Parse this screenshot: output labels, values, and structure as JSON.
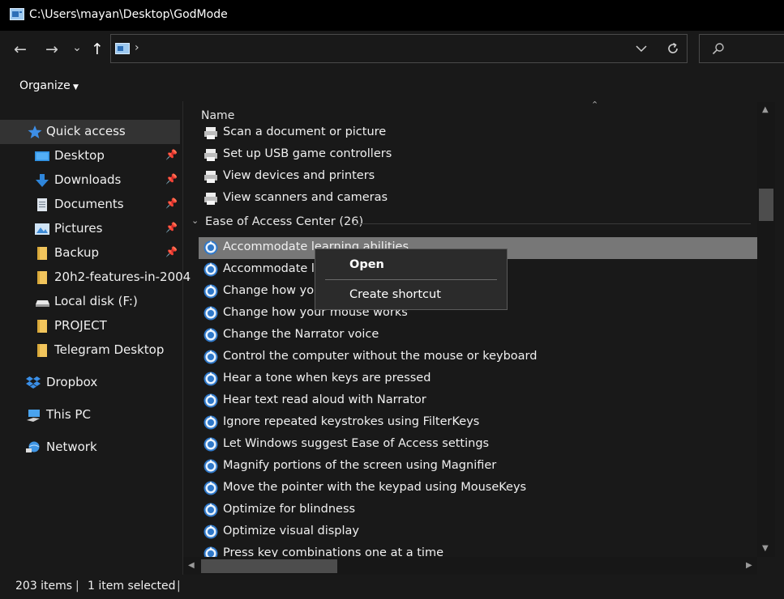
{
  "window": {
    "title": "C:\\Users\\mayan\\Desktop\\GodMode"
  },
  "address": {
    "chevron": "›",
    "dropdown_icon": "chevron-down-icon",
    "refresh_icon": "refresh-icon"
  },
  "nav": {
    "back": "←",
    "forward": "→",
    "recent": "⌄",
    "up": "↑"
  },
  "toolbar": {
    "organize": "Organize"
  },
  "sidebar": {
    "items": [
      {
        "label": "Quick access",
        "icon": "star-icon",
        "pinned": false
      },
      {
        "label": "Desktop",
        "icon": "desktop-icon",
        "pinned": true
      },
      {
        "label": "Downloads",
        "icon": "download-icon",
        "pinned": true
      },
      {
        "label": "Documents",
        "icon": "document-icon",
        "pinned": true
      },
      {
        "label": "Pictures",
        "icon": "pictures-icon",
        "pinned": true
      },
      {
        "label": "Backup",
        "icon": "folder-icon",
        "pinned": true
      },
      {
        "label": "20h2-features-in-2004",
        "icon": "folder-icon",
        "pinned": false
      },
      {
        "label": "Local disk (F:)",
        "icon": "drive-icon",
        "pinned": false
      },
      {
        "label": "PROJECT",
        "icon": "folder-icon",
        "pinned": false
      },
      {
        "label": "Telegram Desktop",
        "icon": "folder-icon",
        "pinned": false
      },
      {
        "label": "Dropbox",
        "icon": "dropbox-icon",
        "pinned": false
      },
      {
        "label": "This PC",
        "icon": "pc-icon",
        "pinned": false
      },
      {
        "label": "Network",
        "icon": "network-icon",
        "pinned": false
      }
    ]
  },
  "list": {
    "column_header": "Name",
    "top_items": [
      "Scan a document or picture",
      "Set up USB game controllers",
      "View devices and printers",
      "View scanners and cameras"
    ],
    "group": {
      "label": "Ease of Access Center (26)"
    },
    "items": [
      "Accommodate learning abilities",
      "Accommodate low vision",
      "Change how your keyboard works",
      "Change how your mouse works",
      "Change the Narrator voice",
      "Control the computer without the mouse or keyboard",
      "Hear a tone when keys are pressed",
      "Hear text read aloud with Narrator",
      "Ignore repeated keystrokes using FilterKeys",
      "Let Windows suggest Ease of Access settings",
      "Magnify portions of the screen using Magnifier",
      "Move the pointer with the keypad using MouseKeys",
      "Optimize for blindness",
      "Optimize visual display",
      "Press key combinations one at a time"
    ]
  },
  "context_menu": {
    "open": "Open",
    "create_shortcut": "Create shortcut"
  },
  "status": {
    "count": "203 items",
    "selected": "1 item selected",
    "sep": "|"
  },
  "colors": {
    "bg": "#191919",
    "titlebar": "#000000",
    "selection": "#777777",
    "accent_blue": "#2e8bdc"
  }
}
